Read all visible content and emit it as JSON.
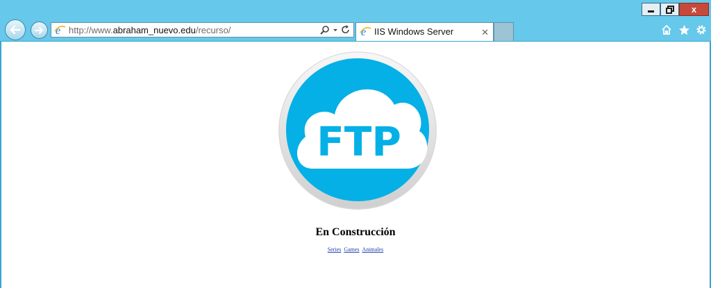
{
  "browser": {
    "address": {
      "prefix": "http://www.",
      "domain": "abraham_nuevo.edu",
      "path": "/recurso/"
    },
    "tab": {
      "title": "IIS Windows Server",
      "close": "✕"
    },
    "window_controls": {
      "close": "x"
    },
    "accent": "#66c8ea"
  },
  "page": {
    "logo_text": "FTP",
    "logo_color": "#04b0e6",
    "title": "En Construcción",
    "links": [
      "Series",
      "Games",
      "Animales"
    ]
  }
}
